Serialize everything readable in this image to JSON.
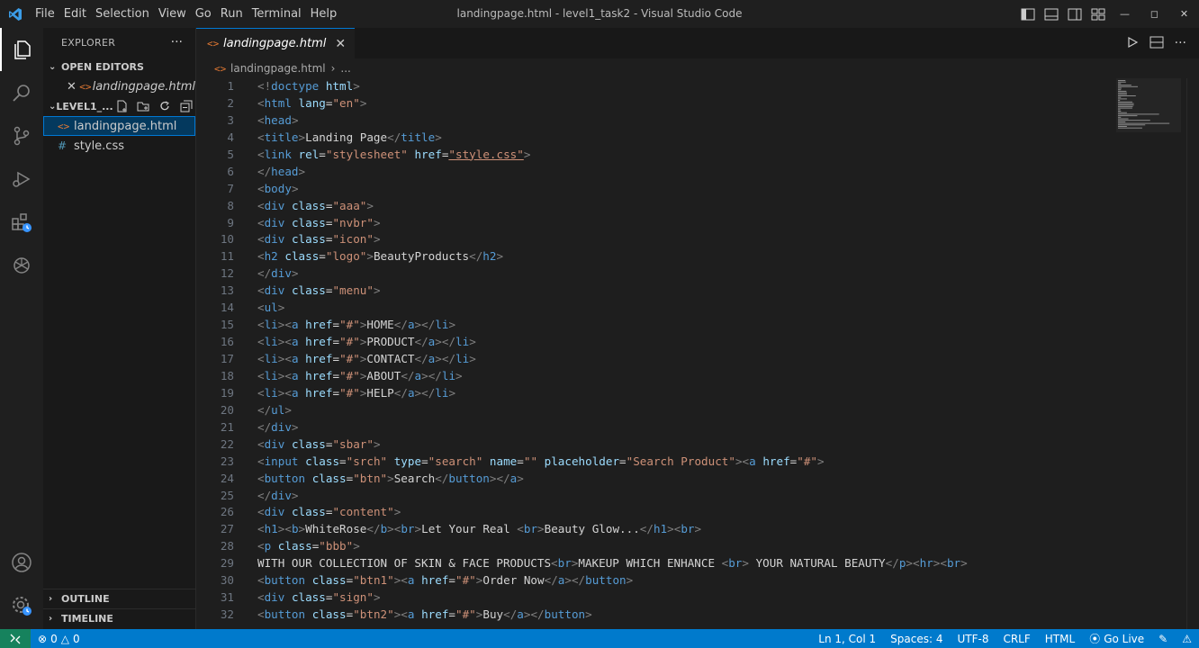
{
  "titlebar": {
    "menu": [
      "File",
      "Edit",
      "Selection",
      "View",
      "Go",
      "Run",
      "Terminal",
      "Help"
    ],
    "window_title": "landingpage.html - level1_task2 - Visual Studio Code"
  },
  "sidebar": {
    "title": "EXPLORER",
    "open_editors_label": "OPEN EDITORS",
    "open_editor_file": "landingpage.html",
    "folder_label": "LEVEL1_...",
    "files": [
      {
        "name": "landingpage.html",
        "icon": "html-icon"
      },
      {
        "name": "style.css",
        "icon": "css-icon"
      }
    ],
    "outline_label": "OUTLINE",
    "timeline_label": "TIMELINE"
  },
  "editor": {
    "tab_label": "landingpage.html",
    "breadcrumb_file": "landingpage.html",
    "breadcrumb_more": "...",
    "lines": [
      {
        "n": "1",
        "text": "<!doctype html>"
      },
      {
        "n": "2",
        "text": "<html lang=\"en\">"
      },
      {
        "n": "3",
        "text": "<head>"
      },
      {
        "n": "4",
        "text": "<title>Landing Page</title>"
      },
      {
        "n": "5",
        "text": "<link rel=\"stylesheet\" href=\"style.css\">"
      },
      {
        "n": "6",
        "text": "</head>"
      },
      {
        "n": "7",
        "text": "<body>"
      },
      {
        "n": "8",
        "text": "<div class=\"aaa\">"
      },
      {
        "n": "9",
        "text": "<div class=\"nvbr\">"
      },
      {
        "n": "10",
        "text": "<div class=\"icon\">"
      },
      {
        "n": "11",
        "text": "<h2 class=\"logo\">BeautyProducts</h2>"
      },
      {
        "n": "12",
        "text": "</div>"
      },
      {
        "n": "13",
        "text": "<div class=\"menu\">"
      },
      {
        "n": "14",
        "text": "<ul>"
      },
      {
        "n": "15",
        "text": "<li><a href=\"#\">HOME</a></li>"
      },
      {
        "n": "16",
        "text": "<li><a href=\"#\">PRODUCT</a></li>"
      },
      {
        "n": "17",
        "text": "<li><a href=\"#\">CONTACT</a></li>"
      },
      {
        "n": "18",
        "text": "<li><a href=\"#\">ABOUT</a></li>"
      },
      {
        "n": "19",
        "text": "<li><a href=\"#\">HELP</a></li>"
      },
      {
        "n": "20",
        "text": "</ul>"
      },
      {
        "n": "21",
        "text": "</div>"
      },
      {
        "n": "22",
        "text": "<div class=\"sbar\">"
      },
      {
        "n": "23",
        "text": "<input class=\"srch\" type=\"search\" name=\"\" placeholder=\"Search Product\"><a href=\"#\">"
      },
      {
        "n": "24",
        "text": "<button class=\"btn\">Search</button></a>"
      },
      {
        "n": "25",
        "text": "</div>"
      },
      {
        "n": "26",
        "text": "<div class=\"content\">"
      },
      {
        "n": "27",
        "text": "<h1><b>WhiteRose</b><br>Let Your Real <br>Beauty Glow...</h1><br>"
      },
      {
        "n": "28",
        "text": "<p class=\"bbb\">"
      },
      {
        "n": "29",
        "text": "WITH OUR COLLECTION OF SKIN & FACE PRODUCTS<br>MAKEUP WHICH ENHANCE <br> YOUR NATURAL BEAUTY</p><hr><br>"
      },
      {
        "n": "30",
        "text": "<button class=\"btn1\"><a href=\"#\">Order Now</a></button>"
      },
      {
        "n": "31",
        "text": "<div class=\"sign\">"
      },
      {
        "n": "32",
        "text": "<button class=\"btn2\"><a href=\"#\">Buy</a></button>"
      }
    ]
  },
  "statusbar": {
    "errors": "0",
    "warnings": "0",
    "position": "Ln 1, Col 1",
    "spaces": "Spaces: 4",
    "encoding": "UTF-8",
    "eol": "CRLF",
    "language": "HTML",
    "golive": "Go Live"
  },
  "colors": {
    "accent": "#007acc",
    "tag": "#808080",
    "tagname": "#569cd6",
    "attr": "#9cdcfe",
    "string": "#ce9178",
    "text": "#d4d4d4"
  }
}
